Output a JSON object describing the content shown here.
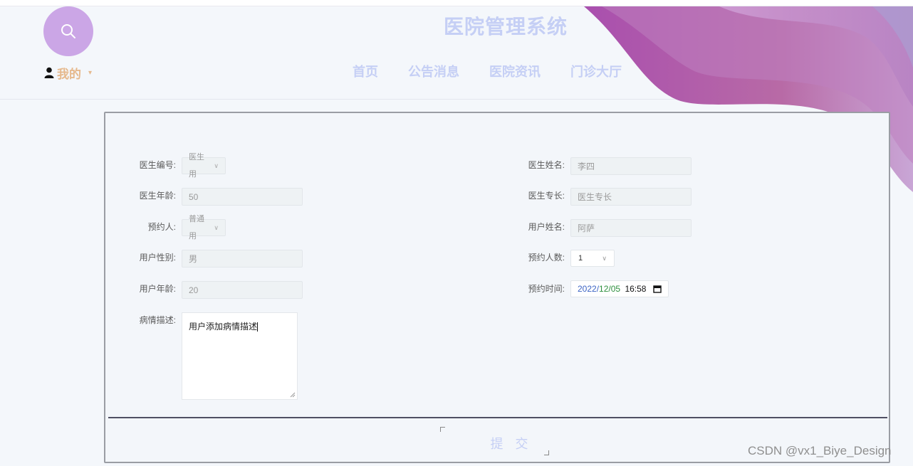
{
  "header": {
    "site_title": "医院管理系统",
    "mine_label": "我的",
    "nav": [
      "首页",
      "公告消息",
      "医院资讯",
      "门诊大厅"
    ]
  },
  "form": {
    "doctor_id_label": "医生编号:",
    "doctor_id_value": "医生用",
    "doctor_name_label": "医生姓名:",
    "doctor_name_value": "李四",
    "doctor_age_label": "医生年龄:",
    "doctor_age_value": "50",
    "doctor_specialty_label": "医生专长:",
    "doctor_specialty_value": "医生专长",
    "booker_label": "预约人:",
    "booker_value": "普通用",
    "user_name_label": "用户姓名:",
    "user_name_value": "阿萨",
    "user_gender_label": "用户性别:",
    "user_gender_value": "男",
    "people_count_label": "预约人数:",
    "people_count_value": "1",
    "user_age_label": "用户年龄:",
    "user_age_value": "20",
    "booking_time_label": "预约时间:",
    "booking_time_year": "2022",
    "booking_time_month": "12",
    "booking_time_day": "05",
    "booking_time_clock": "16:58",
    "illness_label": "病情描述:",
    "illness_value": "用户添加病情描述",
    "submit_label": "提 交"
  },
  "watermark": "CSDN @vx1_Biye_Design",
  "colors": {
    "accent_circle": "#cba6e6",
    "mine_text": "#e6b98d",
    "nav_text": "#c5cff5",
    "wave_dark": "#a94fae",
    "wave_light": "#c38ccd"
  },
  "icons": [
    "search-icon",
    "user-icon",
    "chevron-down-icon",
    "calendar-icon"
  ]
}
